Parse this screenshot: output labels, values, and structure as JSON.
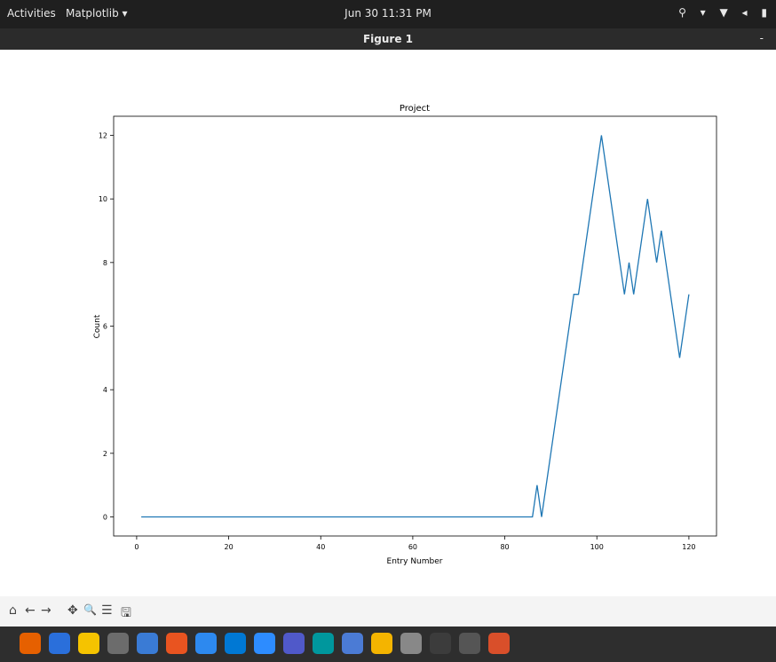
{
  "topbar": {
    "activities": "Activities",
    "app_menu": "Matplotlib ▾",
    "clock": "Jun 30  11:31 PM",
    "tray_icons": [
      "accessibility-icon",
      "network-icon",
      "volume-icon",
      "power-icon"
    ]
  },
  "window": {
    "title": "Figure 1",
    "minimize": "-"
  },
  "chart_data": {
    "type": "line",
    "title": "Project",
    "xlabel": "Entry Number",
    "ylabel": "Count",
    "xlim": [
      -5,
      126
    ],
    "ylim": [
      -0.6,
      12.6
    ],
    "xticks": [
      "0",
      "20",
      "40",
      "60",
      "80",
      "100",
      "120"
    ],
    "yticks": [
      "0",
      "2",
      "4",
      "6",
      "8",
      "10",
      "12"
    ],
    "color": "#1f77b4",
    "grid": false,
    "x": [
      1,
      86,
      87,
      88,
      95,
      96,
      101,
      106,
      107,
      108,
      111,
      113,
      114,
      118,
      120
    ],
    "y": [
      0,
      0,
      1,
      0,
      7,
      7,
      12,
      7,
      8,
      7,
      10,
      8,
      9,
      5,
      7
    ]
  },
  "toolbar": {
    "home": "⌂",
    "back": "←",
    "forward": "→",
    "pan": "✥",
    "zoom": "🔍",
    "configure": "☰",
    "save": "🖫"
  },
  "dock": [
    "firefox-icon",
    "thunderbird-icon",
    "rhythmbox-icon",
    "files-icon",
    "writer-icon",
    "software-icon",
    "help-icon",
    "vscode-icon",
    "zoom-icon",
    "teams-icon",
    "arduino-icon",
    "text-editor-icon",
    "chrome-icon",
    "usb-creator-icon",
    "terminal-icon",
    "blank-icon",
    "app-icon"
  ],
  "dock_colors": [
    "#e66000",
    "#2a6fdb",
    "#f5c300",
    "#6c6c6c",
    "#3a7bd5",
    "#e95420",
    "#2d89ef",
    "#0078d4",
    "#2d8cff",
    "#5059c9",
    "#00979d",
    "#4b7bd5",
    "#f4b400",
    "#888888",
    "#3c3c3c",
    "#555555",
    "#d94f2a"
  ]
}
